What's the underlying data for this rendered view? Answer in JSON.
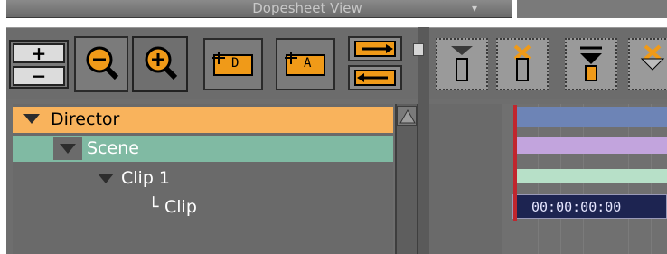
{
  "window": {
    "title": "Dopesheet View"
  },
  "toolbar": {
    "zoom_in_stepper_plus": "+",
    "zoom_in_stepper_minus": "−",
    "button_director_label": "D",
    "button_actor_label": "A"
  },
  "tree": {
    "director": "Director",
    "scene": "Scene",
    "clip": "Clip 1",
    "clip_child": "Clip"
  },
  "timeline": {
    "timecode": "00:00:00:00"
  },
  "colors": {
    "accent_orange": "#f09a18",
    "director_row": "#f9b35c",
    "scene_row": "#80baa3",
    "track_director": "#6d84b6",
    "track_scene": "#c2a4dd",
    "track_clip": "#b7e0c8",
    "playhead": "#c0262e"
  },
  "icons": {
    "zoom_out": "zoom-out-icon",
    "zoom_in": "zoom-in-icon",
    "add_director": "add-director-icon",
    "add_actor": "add-actor-icon",
    "collapse": "collapse-icon",
    "expand": "expand-icon",
    "set_key": "set-key-icon",
    "delete_key": "delete-key-icon",
    "prev_key": "prev-key-icon",
    "next_key": "next-key-icon"
  }
}
